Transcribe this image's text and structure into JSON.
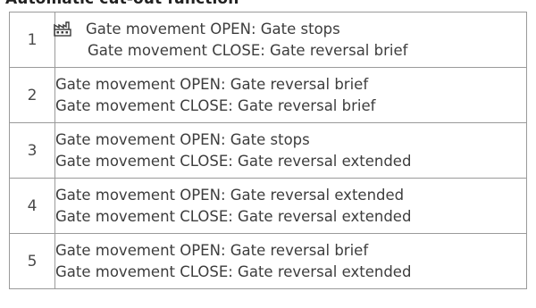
{
  "heading": "Automatic cut-out function",
  "rows": [
    {
      "number": "1",
      "icon": "factory-default-icon",
      "open": "Gate movement OPEN: Gate stops",
      "close": "Gate movement CLOSE: Gate reversal brief"
    },
    {
      "number": "2",
      "open": "Gate movement OPEN: Gate reversal brief",
      "close": "Gate movement CLOSE: Gate reversal brief"
    },
    {
      "number": "3",
      "open": "Gate movement OPEN: Gate stops",
      "close": "Gate movement CLOSE: Gate reversal extended"
    },
    {
      "number": "4",
      "open": "Gate movement OPEN: Gate reversal extended",
      "close": "Gate movement CLOSE: Gate reversal extended"
    },
    {
      "number": "5",
      "open": "Gate movement OPEN: Gate reversal brief",
      "close": "Gate movement CLOSE: Gate reversal extended"
    }
  ]
}
